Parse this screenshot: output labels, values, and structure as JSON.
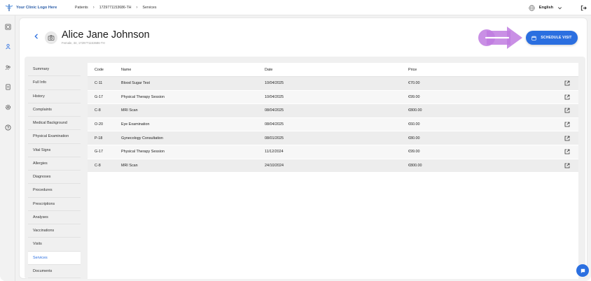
{
  "header": {
    "logo_text": "Your Clinic Logo Here",
    "breadcrumb": [
      "Patients",
      "1729771153686-TH",
      "Services"
    ],
    "language": "English"
  },
  "patient": {
    "name": "Alice Jane Johnson",
    "meta": "Female, 34, 1729771153686-TH"
  },
  "actions": {
    "schedule_visit": "SCHEDULE VISIT"
  },
  "subnav": {
    "items": [
      "Summary",
      "Full Info",
      "History",
      "Complaints",
      "Medical Background",
      "Physical Examination",
      "Vital Signs",
      "Allergies",
      "Diagnoses",
      "Procedures",
      "Prescriptions",
      "Analyses",
      "Vaccinations",
      "Visits",
      "Services",
      "Documents"
    ],
    "active": "Services"
  },
  "table": {
    "columns": {
      "code": "Code",
      "name": "Name",
      "date": "Date",
      "price": "Price"
    },
    "rows": [
      {
        "code": "C-11",
        "name": "Blood Sugar Test",
        "date": "10/04/2025",
        "price": "€70.00"
      },
      {
        "code": "G-17",
        "name": "Physical Therapy Session",
        "date": "10/04/2025",
        "price": "€99.00"
      },
      {
        "code": "C-8",
        "name": "MRI Scan",
        "date": "08/04/2025",
        "price": "€800.00"
      },
      {
        "code": "O-20",
        "name": "Eye Examination",
        "date": "08/04/2025",
        "price": "€60.00"
      },
      {
        "code": "P-18",
        "name": "Gynecology Consultation",
        "date": "08/01/2025",
        "price": "€80.00"
      },
      {
        "code": "G-17",
        "name": "Physical Therapy Session",
        "date": "11/12/2024",
        "price": "€99.00"
      },
      {
        "code": "C-8",
        "name": "MRI Scan",
        "date": "24/10/2024",
        "price": "€800.00"
      }
    ]
  },
  "icons": {
    "rail": [
      "calendar-grid-icon",
      "patient-icon",
      "users-icon",
      "document-icon",
      "settings-icon",
      "help-icon"
    ],
    "open": "open-external-icon",
    "chat": "chat-icon"
  },
  "colors": {
    "accent": "#2b6fe0",
    "highlight_arrow": "#c07be0",
    "logo_text": "#2c5ea8"
  }
}
